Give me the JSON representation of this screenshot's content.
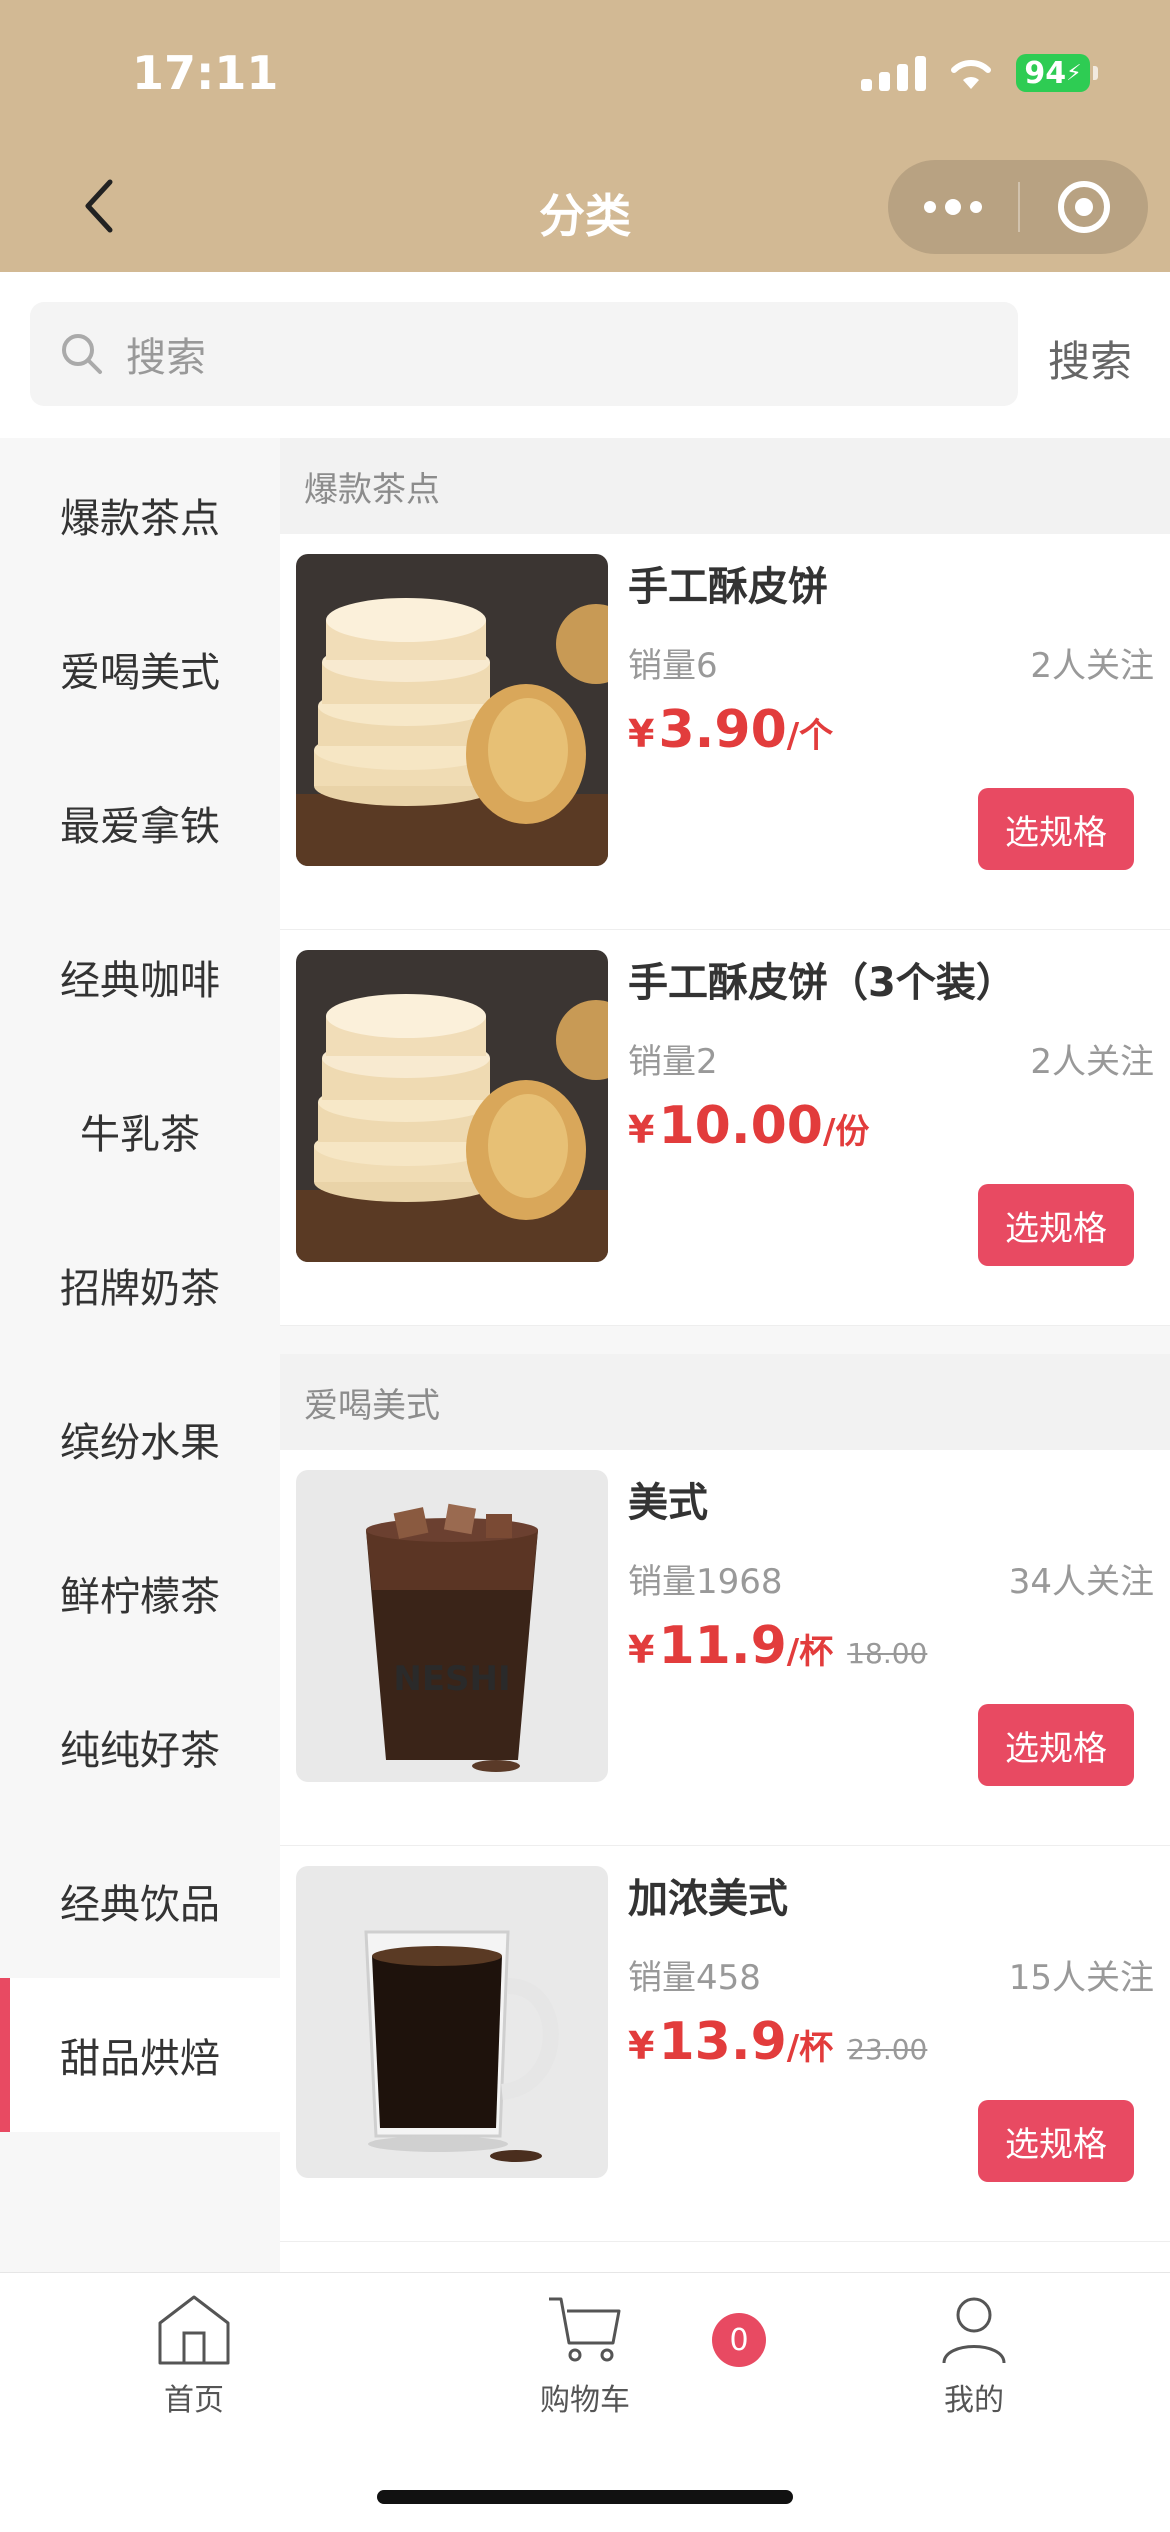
{
  "status_bar": {
    "time": "17:11",
    "battery": "94"
  },
  "nav": {
    "title": "分类"
  },
  "search": {
    "placeholder": "搜索",
    "button": "搜索"
  },
  "sidebar": {
    "items": [
      {
        "label": "爆款茶点"
      },
      {
        "label": "爱喝美式"
      },
      {
        "label": "最爱拿铁"
      },
      {
        "label": "经典咖啡"
      },
      {
        "label": "牛乳茶"
      },
      {
        "label": "招牌奶茶"
      },
      {
        "label": "缤纷水果"
      },
      {
        "label": "鲜柠檬茶"
      },
      {
        "label": "纯纯好茶"
      },
      {
        "label": "经典饮品"
      },
      {
        "label": "甜品烘焙"
      }
    ],
    "active_index": 10
  },
  "sections": [
    {
      "title": "爆款茶点",
      "products": [
        {
          "name": "手工酥皮饼",
          "sales": "销量6",
          "follow": "2人关注",
          "currency": "¥",
          "price": "3.90",
          "unit": "/个",
          "original_price": "",
          "button": "选规格",
          "image": "pastry-stack"
        },
        {
          "name": "手工酥皮饼（3个装）",
          "sales": "销量2",
          "follow": "2人关注",
          "currency": "¥",
          "price": "10.00",
          "unit": "/份",
          "original_price": "",
          "button": "选规格",
          "image": "pastry-stack"
        }
      ]
    },
    {
      "title": "爱喝美式",
      "products": [
        {
          "name": "美式",
          "sales": "销量1968",
          "follow": "34人关注",
          "currency": "¥",
          "price": "11.9",
          "unit": "/杯",
          "original_price": "18.00",
          "button": "选规格",
          "image": "iced-americano-cup"
        },
        {
          "name": "加浓美式",
          "sales": "销量458",
          "follow": "15人关注",
          "currency": "¥",
          "price": "13.9",
          "unit": "/杯",
          "original_price": "23.00",
          "button": "选规格",
          "image": "hot-americano-mug"
        }
      ]
    }
  ],
  "tabbar": {
    "home": "首页",
    "cart": "购物车",
    "cart_count": "0",
    "mine": "我的"
  },
  "colors": {
    "header_bg": "#d2b994",
    "accent": "#e84a62",
    "price": "#e23c3c"
  }
}
